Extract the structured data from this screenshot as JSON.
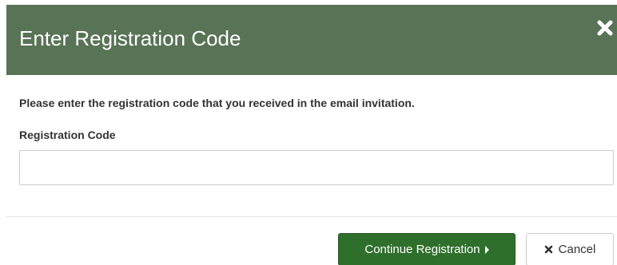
{
  "modal": {
    "title": "Enter Registration Code",
    "close_icon": "close-icon"
  },
  "body": {
    "instructions": "Please enter the registration code that you received in the email invitation.",
    "field_label": "Registration Code",
    "field_value": "",
    "field_placeholder": ""
  },
  "footer": {
    "continue_label": "Continue Registration",
    "continue_icon": "caret-right-icon",
    "cancel_label": "Cancel",
    "cancel_icon": "close-icon"
  },
  "colors": {
    "header_bg": "#587355",
    "primary_button": "#2f6f2c"
  }
}
